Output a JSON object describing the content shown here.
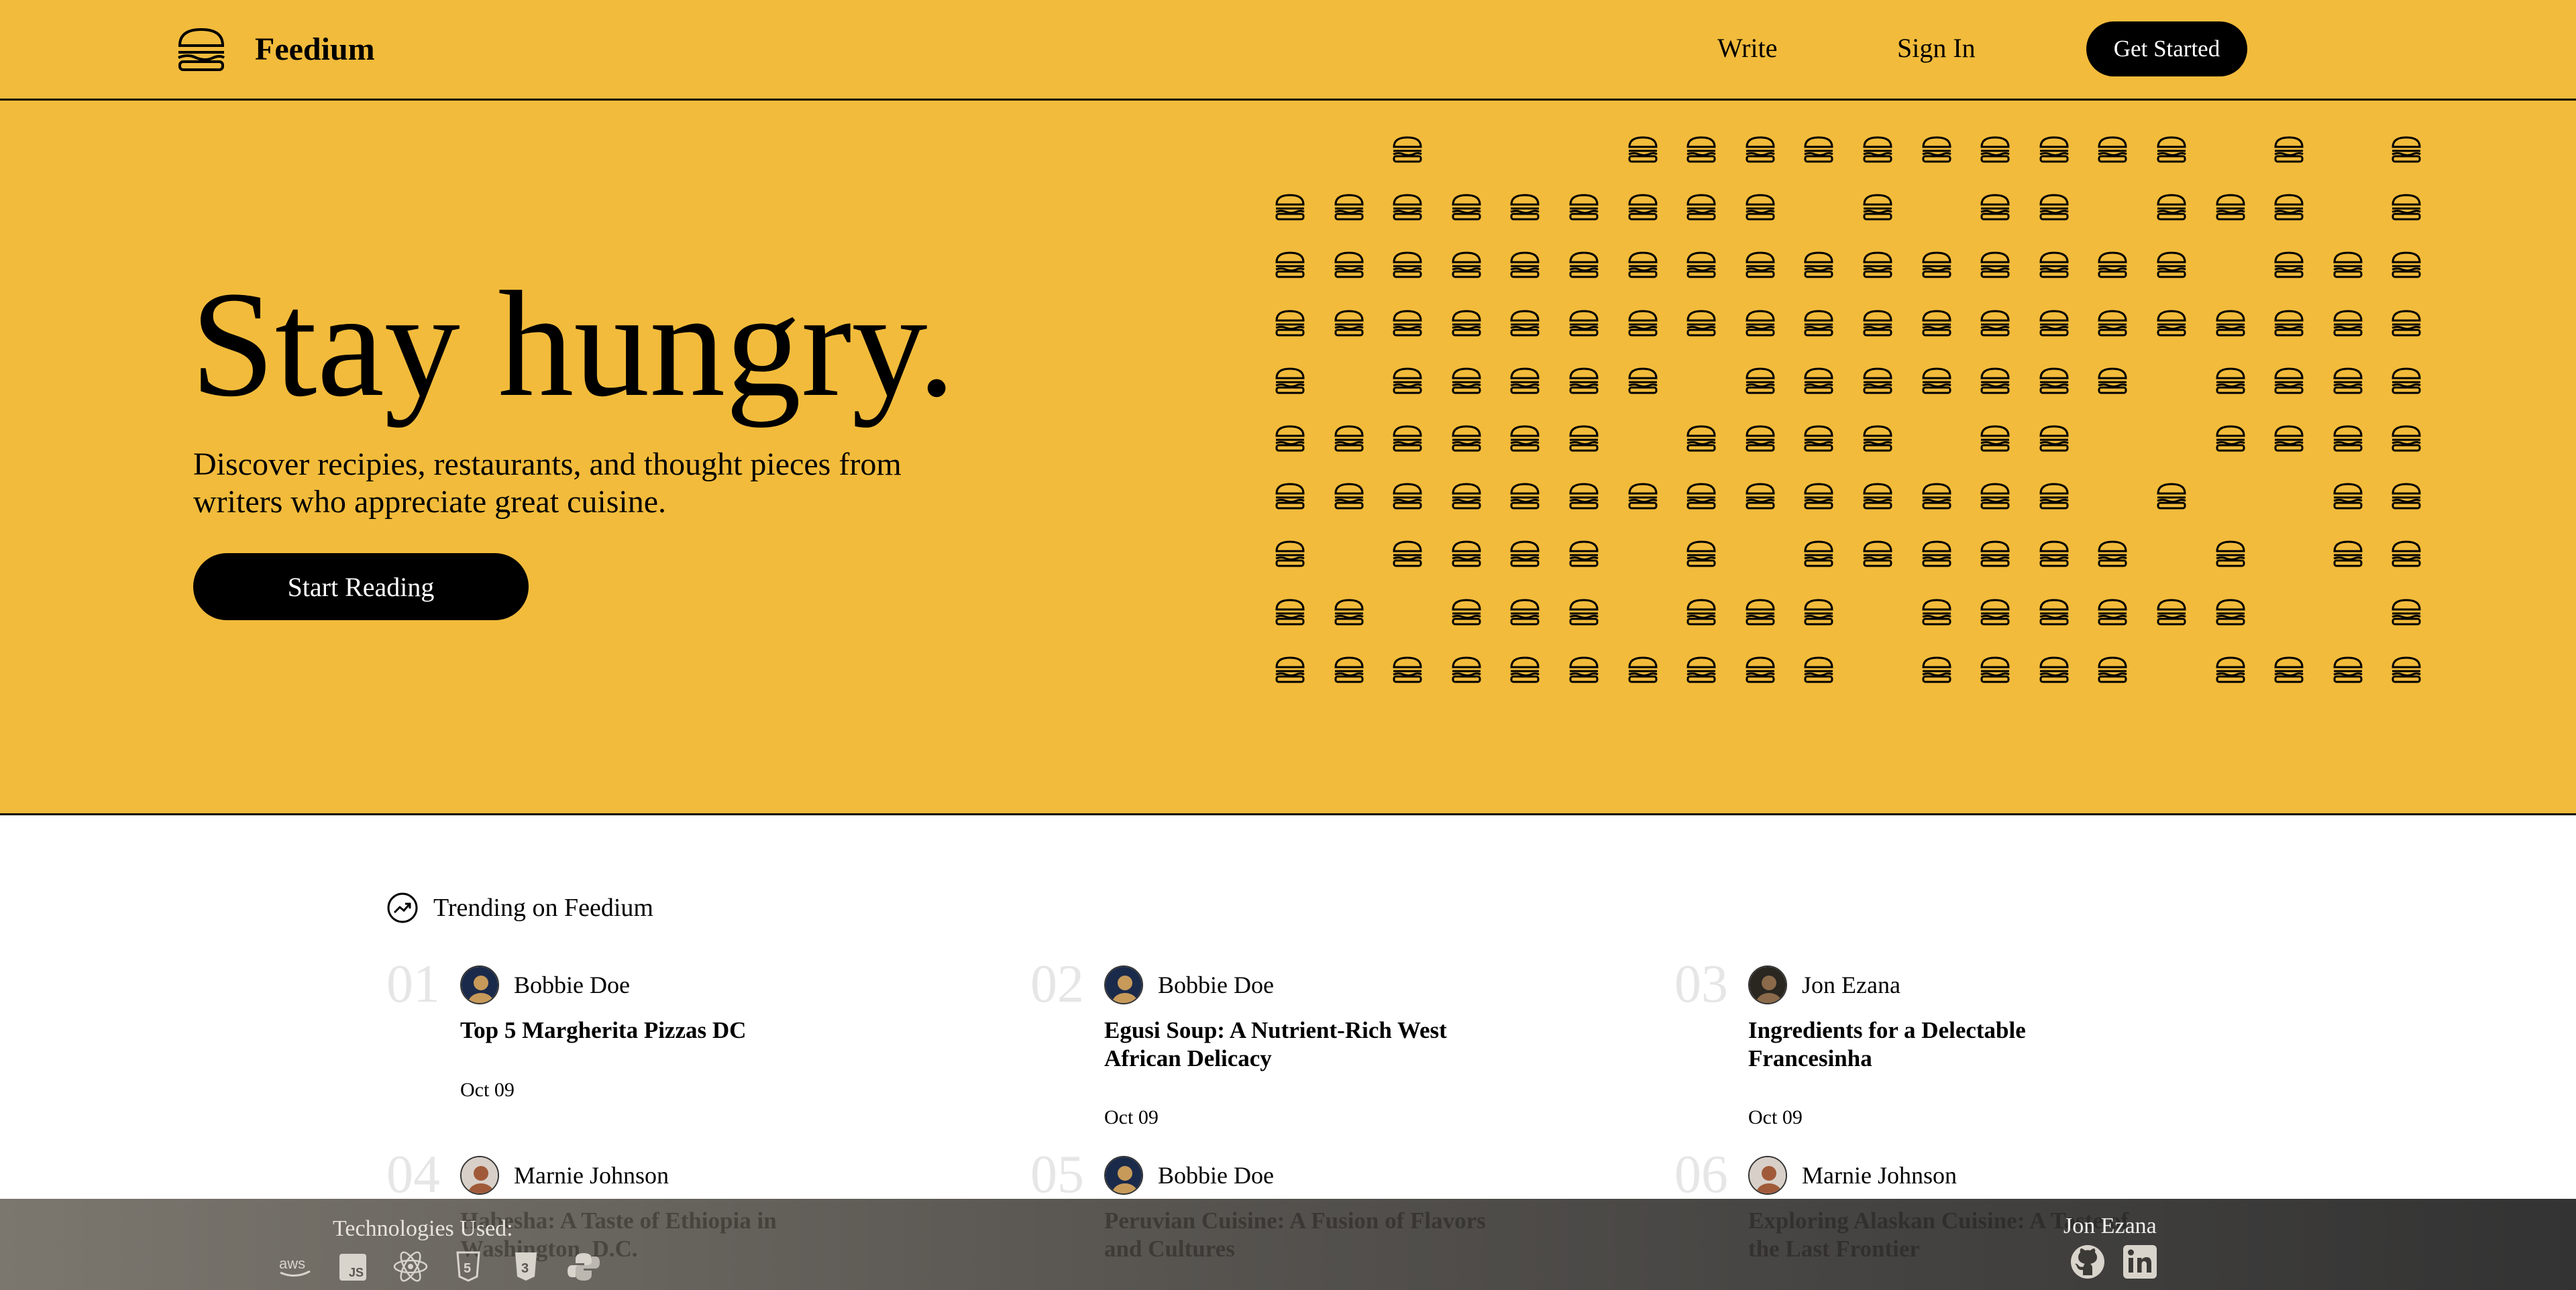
{
  "header": {
    "brand": "Feedium",
    "nav": {
      "write": "Write",
      "sign_in": "Sign In",
      "get_started": "Get Started"
    }
  },
  "hero": {
    "title": "Stay hungry.",
    "subtitle": "Discover recipies, restaurants, and thought pieces from writers who appreciate great cuisine.",
    "cta": "Start Reading"
  },
  "trending": {
    "label": "Trending on Feedium",
    "articles": [
      {
        "num": "01",
        "author": "Bobbie Doe",
        "title": "Top 5 Margherita Pizzas DC",
        "date": "Oct 09"
      },
      {
        "num": "02",
        "author": "Bobbie Doe",
        "title": "Egusi Soup: A Nutrient-Rich West African Delicacy",
        "date": "Oct 09"
      },
      {
        "num": "03",
        "author": "Jon Ezana",
        "title": "Ingredients for a Delectable Francesinha",
        "date": "Oct 09"
      },
      {
        "num": "04",
        "author": "Marnie Johnson",
        "title": "Habesha: A Taste of Ethiopia in Washington, D.C.",
        "date": ""
      },
      {
        "num": "05",
        "author": "Bobbie Doe",
        "title": "Peruvian Cuisine: A Fusion of Flavors and Cultures",
        "date": ""
      },
      {
        "num": "06",
        "author": "Marnie Johnson",
        "title": "Exploring Alaskan Cuisine: A Taste of the Last Frontier",
        "date": ""
      }
    ]
  },
  "footer": {
    "tech_label": "Technologies Used:",
    "tech_icons": [
      "aws-icon",
      "javascript-icon",
      "react-icon",
      "html5-icon",
      "css3-icon",
      "python-icon"
    ],
    "developer": "Jon Ezana",
    "social_icons": [
      "github-icon",
      "linkedin-icon"
    ]
  },
  "colors": {
    "brand_yellow": "#f2bb3b",
    "text": "#000000",
    "number_gray": "#e6e6e6"
  }
}
